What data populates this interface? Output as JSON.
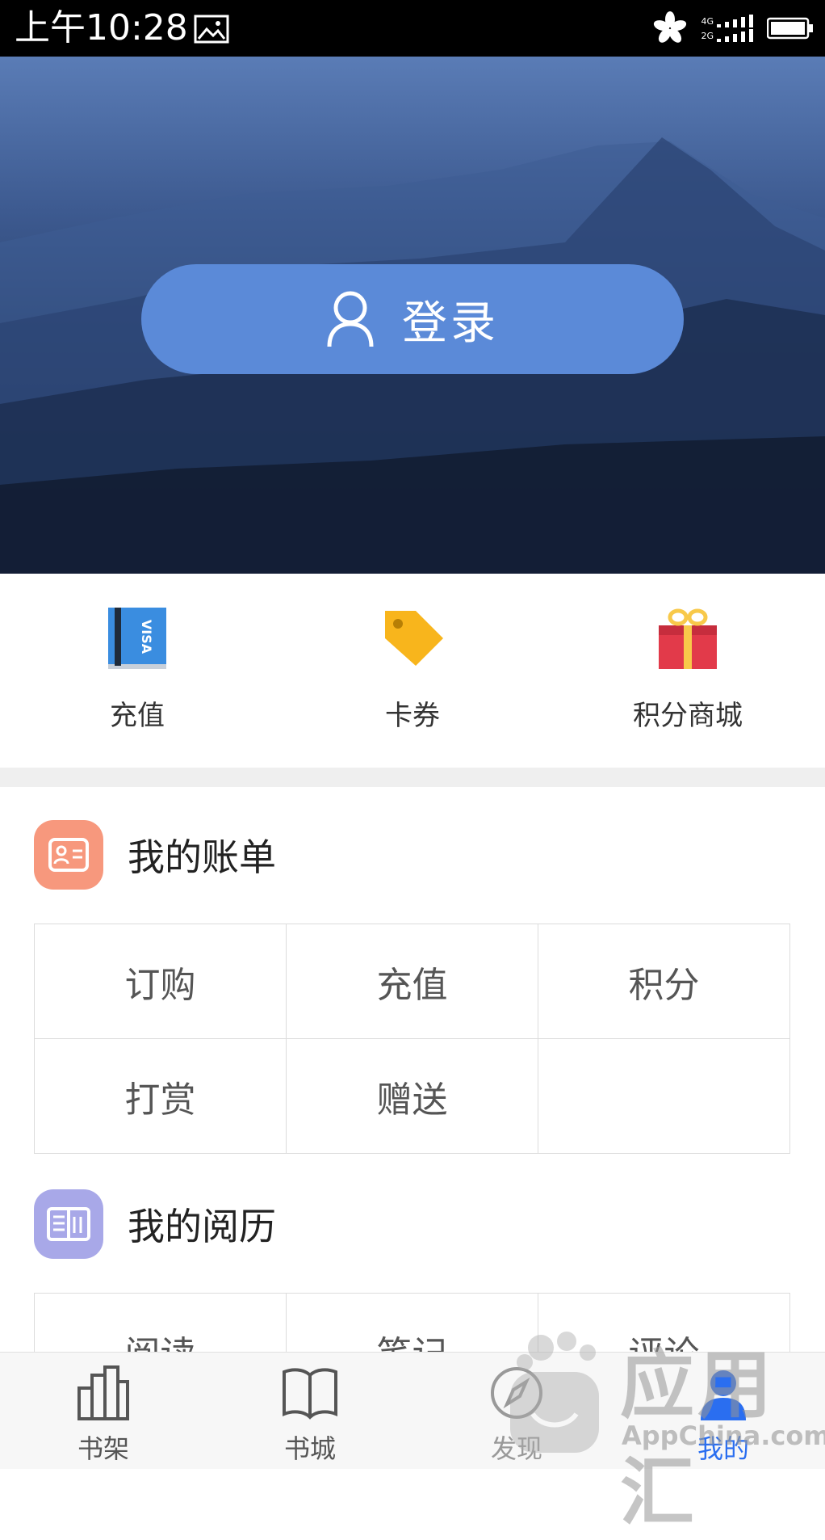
{
  "status_bar": {
    "time": "上午10:28",
    "network_top": "4G",
    "network_bottom": "2G"
  },
  "login": {
    "label": "登录"
  },
  "quick_actions": [
    {
      "label": "充值",
      "icon": "visa-card-icon"
    },
    {
      "label": "卡券",
      "icon": "tag-icon"
    },
    {
      "label": "积分商城",
      "icon": "gift-icon"
    }
  ],
  "bills": {
    "title": "我的账单",
    "items": [
      "订购",
      "充值",
      "积分",
      "打赏",
      "赠送",
      ""
    ]
  },
  "history": {
    "title": "我的阅历",
    "items": [
      "阅读",
      "笔记",
      "评论"
    ]
  },
  "tabs": [
    {
      "label": "书架",
      "icon": "bookshelf-icon"
    },
    {
      "label": "书城",
      "icon": "book-icon"
    },
    {
      "label": "发现",
      "icon": "compass-icon"
    },
    {
      "label": "我的",
      "icon": "person-icon",
      "active": true
    }
  ],
  "watermark": {
    "big": "应用汇",
    "small": "AppChina.com"
  },
  "colors": {
    "accent": "#5b8ad8",
    "tab_active": "#2a6ef0",
    "bill_icon": "#f7987d",
    "history_icon": "#a8a8e8"
  }
}
